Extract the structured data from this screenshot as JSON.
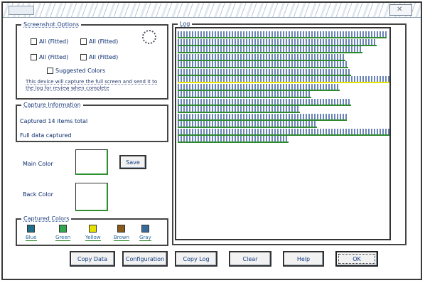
{
  "window": {
    "title": "",
    "close_glyph": "✕"
  },
  "options": {
    "legend": "Screenshot Options",
    "checkboxes": [
      {
        "label": "All (Fitted)",
        "checked": true
      },
      {
        "label": "All (Fitted)",
        "checked": false
      },
      {
        "label": "All (Fitted)",
        "checked": true
      },
      {
        "label": "All (Fitted)",
        "checked": false
      },
      {
        "label": "Suggested Colors",
        "checked": true
      }
    ],
    "description": "This device will capture the full screen and send it to the log for review when complete"
  },
  "info": {
    "legend": "Capture Information",
    "line1": "Captured 14 items total",
    "line2": "Full data captured"
  },
  "colors": {
    "main_label": "Main Color",
    "back_label": "Back Color",
    "save_label": "Save",
    "legend": "Captured Colors",
    "palette": [
      {
        "name": "Blue",
        "hex": "#1f6e8a"
      },
      {
        "name": "Green",
        "hex": "#2fa84f"
      },
      {
        "name": "Yellow",
        "hex": "#e6e200"
      },
      {
        "name": "Brown",
        "hex": "#8a5a1a"
      },
      {
        "name": "Gray",
        "hex": "#3a6a9a"
      }
    ]
  },
  "log": {
    "legend": "Log",
    "lines": [
      {
        "text": "",
        "highlight": false
      },
      {
        "text": "",
        "highlight": false
      },
      {
        "text": "",
        "highlight": false
      },
      {
        "text": "",
        "highlight": false
      },
      {
        "text": "",
        "highlight": false
      },
      {
        "text": "",
        "highlight": false
      },
      {
        "text": "",
        "highlight": true
      },
      {
        "text": "",
        "highlight": false
      },
      {
        "text": "",
        "highlight": false
      },
      {
        "text": "",
        "highlight": false
      },
      {
        "text": "",
        "highlight": false
      },
      {
        "text": "",
        "highlight": false
      },
      {
        "text": "",
        "highlight": false
      },
      {
        "text": "",
        "highlight": false
      },
      {
        "text": "",
        "highlight": false
      }
    ]
  },
  "footer": {
    "buttons": [
      "Copy Data",
      "Configuration",
      "Copy Log",
      "Clear",
      "Help",
      "OK"
    ]
  }
}
